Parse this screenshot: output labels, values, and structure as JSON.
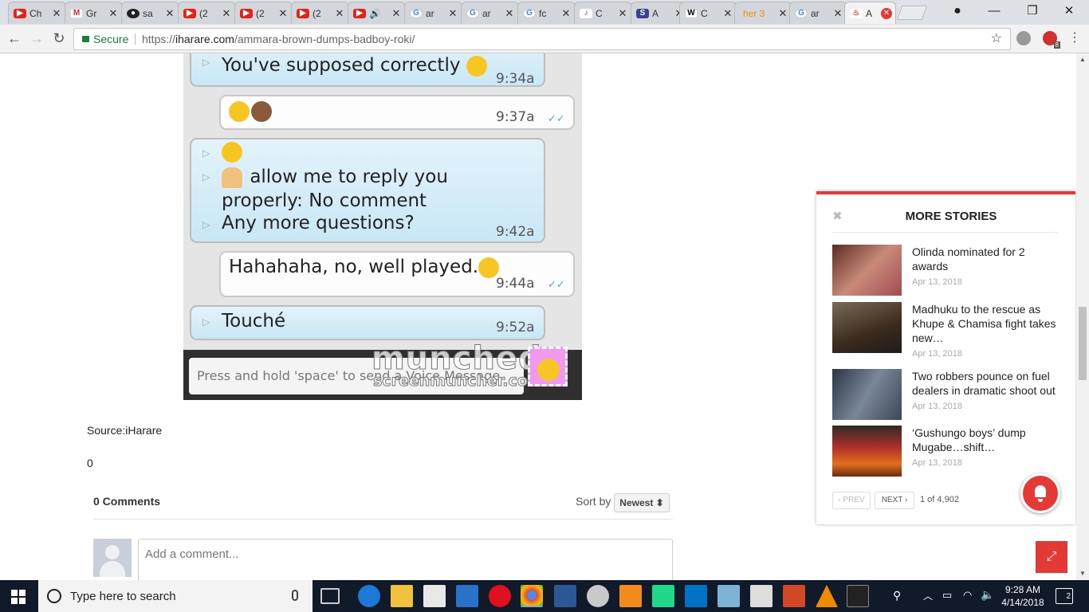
{
  "browser": {
    "tabs": [
      {
        "label": "Ch",
        "icon": "youtube-icon"
      },
      {
        "label": "Gr",
        "icon": "gmail-icon"
      },
      {
        "label": "sa",
        "icon": "github-icon"
      },
      {
        "label": "(2",
        "icon": "youtube-icon"
      },
      {
        "label": "(2",
        "icon": "youtube-icon"
      },
      {
        "label": "(2",
        "icon": "youtube-icon"
      },
      {
        "label": "",
        "icon": "youtube-audio-icon"
      },
      {
        "label": "ar",
        "icon": "google-icon"
      },
      {
        "label": "ar",
        "icon": "google-icon"
      },
      {
        "label": "fc",
        "icon": "google-icon"
      },
      {
        "label": "C",
        "icon": "violin-icon"
      },
      {
        "label": "A",
        "icon": "s-icon"
      },
      {
        "label": "C",
        "icon": "wikipedia-icon"
      },
      {
        "label": "her 3",
        "icon": ""
      },
      {
        "label": "ar",
        "icon": "google-icon"
      },
      {
        "label": "A",
        "icon": "fire-icon"
      }
    ],
    "secure_label": "Secure",
    "url_prefix": "https://",
    "url_host": "iharare.com",
    "url_path": "/ammara-brown-dumps-badboy-roki/",
    "ext_badge": "8"
  },
  "chat": {
    "m1_text": "You've supposed correctly",
    "m1_time": "9:34a",
    "m2_time": "9:37a",
    "m3_line2": "allow me to reply you",
    "m3_line3": "properly: No comment",
    "m3_line4": "Any more questions?",
    "m3_time": "9:42a",
    "m4_text": "Hahahaha, no, well played.",
    "m4_time": "9:44a",
    "m5_text": "Touché",
    "m5_time": "9:52a",
    "input_placeholder": "Press and hold 'space' to send a Voice Message",
    "watermark_big": "munched",
    "watermark_small": "screenmuncher.com"
  },
  "article": {
    "source": "Source:iHarare",
    "count": "0"
  },
  "comments": {
    "count_label": "0 Comments",
    "sort_label": "Sort by",
    "sort_value": "Newest ⬍",
    "placeholder": "Add a comment..."
  },
  "more_stories": {
    "title": "MORE STORIES",
    "close": "✖",
    "items": [
      {
        "title": "Olinda nominated for 2 awards",
        "date": "Apr 13, 2018"
      },
      {
        "title": "Madhuku to the rescue as Khupe & Chamisa fight takes new…",
        "date": "Apr 13, 2018"
      },
      {
        "title": "Two robbers pounce on fuel dealers in dramatic shoot out",
        "date": "Apr 13, 2018"
      },
      {
        "title": "‘Gushungo boys’ dump Mugabe…shift…",
        "date": "Apr 13, 2018"
      }
    ],
    "prev": "‹ PREV",
    "next": "NEXT ›",
    "page_info": "1 of 4,902"
  },
  "taskbar": {
    "search_placeholder": "Type here to search",
    "time": "9:28 AM",
    "date": "4/14/2018",
    "notifications": "2"
  }
}
